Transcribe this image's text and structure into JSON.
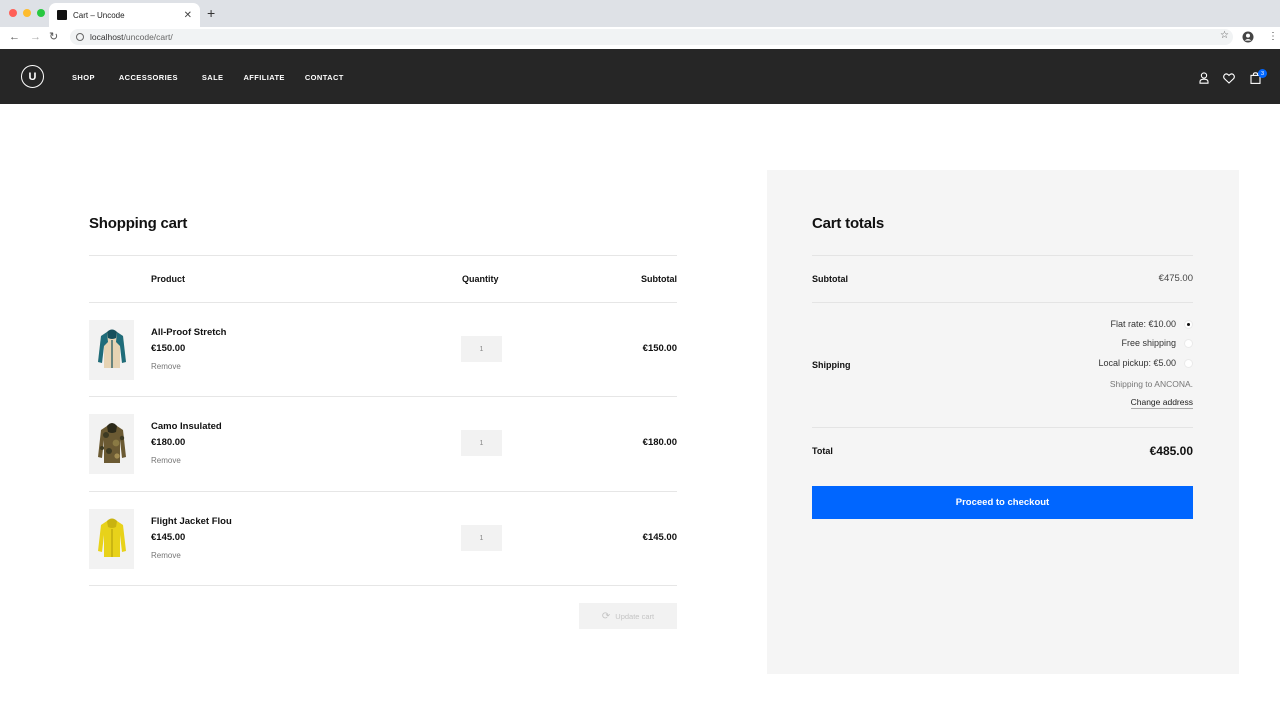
{
  "browser": {
    "tab_title": "Cart – Uncode",
    "url_host": "localhost",
    "url_path": "/uncode/cart/",
    "traffic_colors": [
      "#ff5f57",
      "#febc2e",
      "#28c840"
    ]
  },
  "header": {
    "logo_letter": "U",
    "menu": [
      "SHOP",
      "ACCESSORIES",
      "SALE",
      "AFFILIATE",
      "CONTACT"
    ],
    "cart_count": "3",
    "bg_color": "#262626"
  },
  "cart": {
    "title": "Shopping cart",
    "col_product": "Product",
    "col_quantity": "Quantity",
    "col_subtotal": "Subtotal",
    "items": [
      {
        "name": "All-Proof Stretch",
        "price": "€150.00",
        "remove": "Remove",
        "qty": "1",
        "subtotal": "€150.00"
      },
      {
        "name": "Camo Insulated",
        "price": "€180.00",
        "remove": "Remove",
        "qty": "1",
        "subtotal": "€180.00"
      },
      {
        "name": "Flight Jacket Flou",
        "price": "€145.00",
        "remove": "Remove",
        "qty": "1",
        "subtotal": "€145.00"
      }
    ],
    "update_label": "Update cart"
  },
  "totals": {
    "title": "Cart totals",
    "subtotal_label": "Subtotal",
    "subtotal_value": "€475.00",
    "shipping_label": "Shipping",
    "shipping_options": [
      {
        "label": "Flat rate: €10.00",
        "selected": true
      },
      {
        "label": "Free shipping",
        "selected": false
      },
      {
        "label": "Local pickup: €5.00",
        "selected": false
      }
    ],
    "shipping_to": "Shipping to ANCONA.",
    "change_address": "Change address",
    "total_label": "Total",
    "total_value": "€485.00",
    "checkout_label": "Proceed to checkout",
    "accent_color": "#0066ff"
  }
}
